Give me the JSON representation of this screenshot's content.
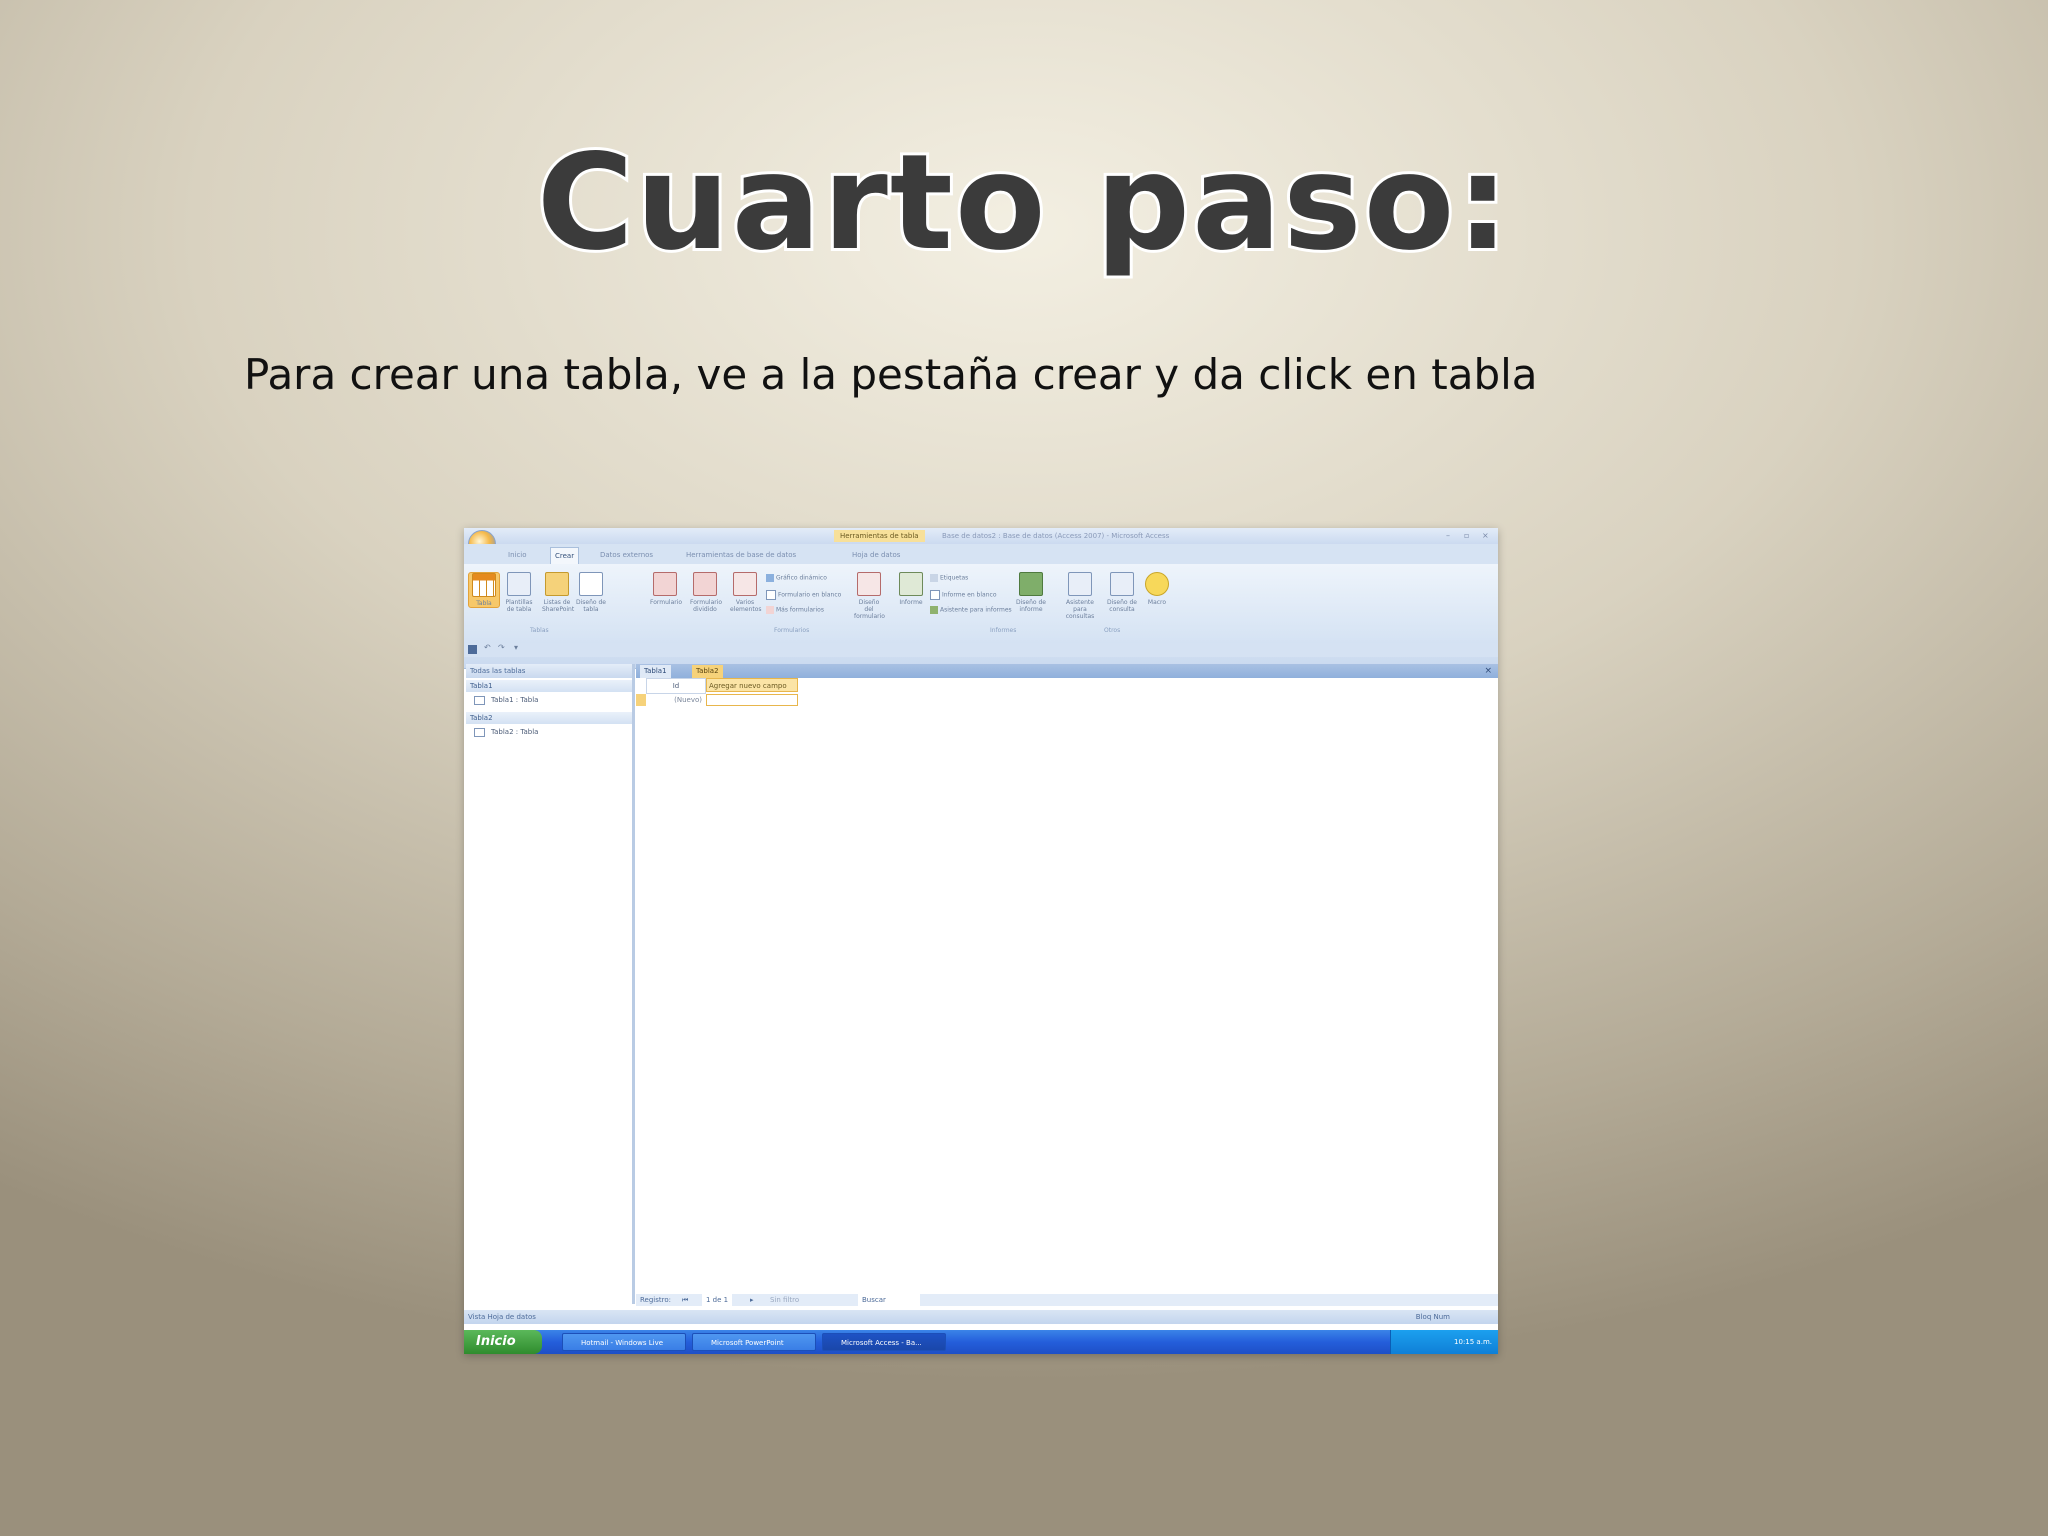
{
  "slide": {
    "title": "Cuarto paso:",
    "subtitle": "Para crear una tabla, ve a la pestaña crear y da click en tabla"
  },
  "screenshot": {
    "window_title": "Base de datos2 : Base de datos (Access 2007) - Microsoft Access",
    "context_tab": "Herramientas de tabla",
    "tabs": [
      "Inicio",
      "Crear",
      "Datos externos",
      "Herramientas de base de datos",
      "Hoja de datos"
    ],
    "active_tab": "Crear",
    "ribbon_groups": {
      "tablas": "Tablas",
      "formularios": "Formularios",
      "informes": "Informes",
      "otros": "Otros"
    },
    "ribbon_buttons": {
      "tabla": "Tabla",
      "plantillas": "Plantillas de tabla",
      "listas": "Listas de SharePoint",
      "diseno_tabla": "Diseño de tabla",
      "formulario": "Formulario",
      "formulario_dividido": "Formulario dividido",
      "varios_elementos": "Varios elementos",
      "grafico_dinamico": "Gráfico dinámico",
      "formulario_blanco": "Formulario en blanco",
      "mas_formularios": "Más formularios",
      "diseno_formulario": "Diseño del formulario",
      "informe": "Informe",
      "etiquetas": "Etiquetas",
      "informe_blanco": "Informe en blanco",
      "asistente_informes": "Asistente para informes",
      "diseno_informe": "Diseño de informe",
      "asistente_consultas": "Asistente para consultas",
      "diseno_consulta": "Diseño de consulta",
      "macro": "Macro"
    },
    "nav_pane": {
      "header": "Todas las tablas",
      "groups": [
        {
          "name": "Tabla1",
          "item": "Tabla1 : Tabla"
        },
        {
          "name": "Tabla2",
          "item": "Tabla2 : Tabla"
        }
      ]
    },
    "doc_tabs": [
      "Tabla1",
      "Tabla2"
    ],
    "active_doc_tab": "Tabla2",
    "grid": {
      "col_id": "Id",
      "col_new": "Agregar nuevo campo",
      "new_row_value": "(Nuevo)"
    },
    "record_nav": {
      "label": "Registro:",
      "position": "1 de 1",
      "filter": "Sin filtro",
      "search": "Buscar"
    },
    "status": {
      "left": "Vista Hoja de datos",
      "right": "Bloq Num"
    },
    "taskbar": {
      "start": "Inicio",
      "buttons": [
        "Hotmail - Windows Live",
        "Microsoft PowerPoint",
        "Microsoft Access - Ba..."
      ],
      "clock": "10:15 a.m."
    },
    "colors": {
      "accent": "#f7c86a",
      "ribbon": "#d7e4f4",
      "taskbar": "#245edb"
    }
  }
}
